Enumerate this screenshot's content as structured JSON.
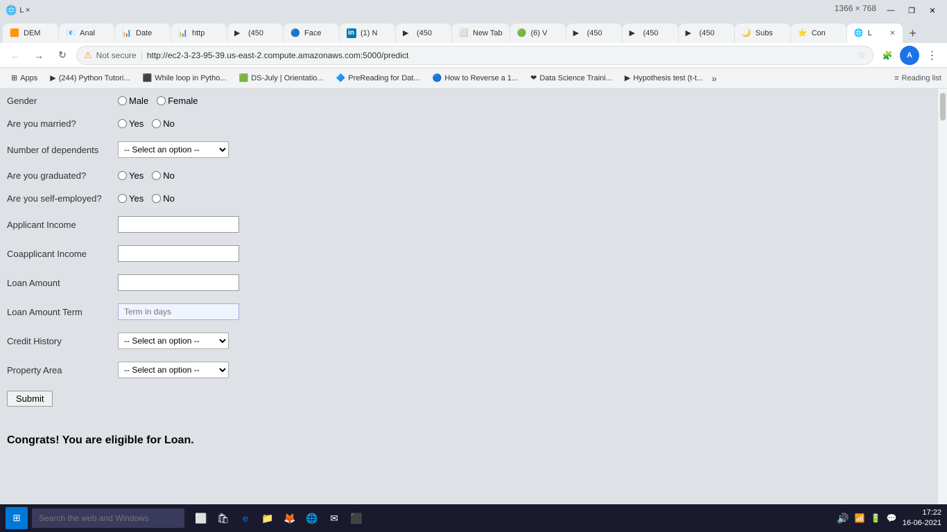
{
  "browser": {
    "title": "L ×",
    "url": "http://ec2-3-23-95-39.us-east-2.compute.amazonaws.com:5000/predict",
    "url_prefix": "Not secure",
    "tabs": [
      {
        "label": "DEM",
        "favicon": "🟧",
        "active": false
      },
      {
        "label": "Anal",
        "favicon": "📧",
        "active": false
      },
      {
        "label": "Date",
        "favicon": "📊",
        "active": false
      },
      {
        "label": "http",
        "favicon": "📊",
        "active": false
      },
      {
        "label": "(450",
        "favicon": "▶",
        "active": false
      },
      {
        "label": "Face",
        "favicon": "🔵",
        "active": false
      },
      {
        "label": "(1) N",
        "favicon": "in",
        "active": false
      },
      {
        "label": "(450",
        "favicon": "▶",
        "active": false
      },
      {
        "label": "New Tab",
        "favicon": "⬜",
        "active": false
      },
      {
        "label": "(6) V",
        "favicon": "🟢",
        "active": false
      },
      {
        "label": "(450",
        "favicon": "▶",
        "active": false
      },
      {
        "label": "(450",
        "favicon": "▶",
        "active": false
      },
      {
        "label": "(450",
        "favicon": "▶",
        "active": false
      },
      {
        "label": "Subs",
        "favicon": "🌙",
        "active": false
      },
      {
        "label": "Con",
        "favicon": "⭐",
        "active": false
      },
      {
        "label": "L",
        "favicon": "🌐",
        "active": true
      }
    ],
    "new_tab_label": "+",
    "bookmarks": [
      {
        "label": "Apps",
        "favicon": "⊞"
      },
      {
        "label": "(244) Python Tutori...",
        "favicon": "▶"
      },
      {
        "label": "While loop in Pytho...",
        "favicon": "⬛"
      },
      {
        "label": "DS-July | Orientatio...",
        "favicon": "🟩"
      },
      {
        "label": "PreReading for Dat...",
        "favicon": "🔷"
      },
      {
        "label": "How to Reverse a 1...",
        "favicon": "🔵"
      },
      {
        "label": "Data Science Traini...",
        "favicon": "❤"
      },
      {
        "label": "Hypothesis test (t-t...",
        "favicon": "▶"
      }
    ],
    "bookmarks_more": "»",
    "reading_list_label": "Reading list"
  },
  "form": {
    "gender_label": "Gender",
    "gender_options": [
      "Male",
      "Female"
    ],
    "married_label": "Are you married?",
    "married_options": [
      "Yes",
      "No"
    ],
    "dependents_label": "Number of dependents",
    "dependents_select_default": "-- Select an option --",
    "graduated_label": "Are you graduated?",
    "graduated_options": [
      "Yes",
      "No"
    ],
    "self_employed_label": "Are you self-employed?",
    "self_employed_options": [
      "Yes",
      "No"
    ],
    "applicant_income_label": "Applicant Income",
    "coapplicant_income_label": "Coapplicant Income",
    "loan_amount_label": "Loan Amount",
    "loan_term_label": "Loan Amount Term",
    "loan_term_placeholder": "Term in days",
    "credit_history_label": "Credit History",
    "credit_history_select_default": "-- Select an option --",
    "property_area_label": "Property Area",
    "property_area_select_default": "-- Select an option --",
    "submit_label": "Submit",
    "result_text": "Congrats! You are eligible for Loan."
  },
  "taskbar": {
    "search_placeholder": "Search the web and Windows",
    "time": "17:22",
    "date": "16-06-2021"
  },
  "window_controls": {
    "minimize": "—",
    "maximize": "❐",
    "close": "✕"
  }
}
